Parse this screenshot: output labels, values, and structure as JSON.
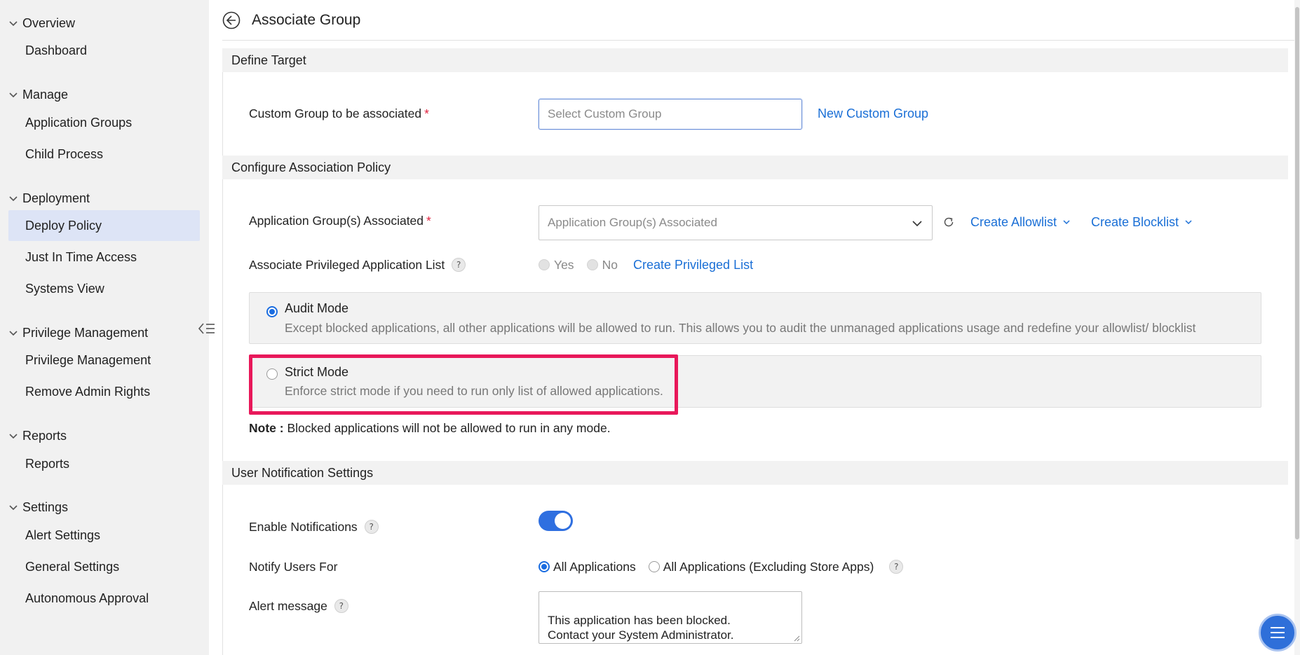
{
  "sidebar": {
    "sections": [
      {
        "title": "Overview",
        "items": [
          "Dashboard"
        ]
      },
      {
        "title": "Manage",
        "items": [
          "Application Groups",
          "Child Process"
        ]
      },
      {
        "title": "Deployment",
        "items": [
          "Deploy Policy",
          "Just In Time Access",
          "Systems View"
        ]
      },
      {
        "title": "Privilege Management",
        "items": [
          "Privilege Management",
          "Remove Admin Rights"
        ]
      },
      {
        "title": "Reports",
        "items": [
          "Reports"
        ]
      },
      {
        "title": "Settings",
        "items": [
          "Alert Settings",
          "General Settings",
          "Autonomous Approval"
        ]
      }
    ],
    "active_item": "Deploy Policy"
  },
  "header": {
    "title": "Associate Group"
  },
  "define_target": {
    "section_title": "Define Target",
    "custom_group_label": "Custom Group to be associated",
    "required_mark": "*",
    "custom_group_placeholder": "Select Custom Group",
    "new_custom_group_link": "New Custom Group"
  },
  "policy": {
    "section_title": "Configure Association Policy",
    "app_groups_label": "Application Group(s) Associated",
    "required_mark": "*",
    "app_groups_placeholder": "Application Group(s) Associated",
    "create_allowlist": "Create Allowlist",
    "create_blocklist": "Create Blocklist",
    "privileged_label": "Associate Privileged Application List",
    "help_mark": "?",
    "yes_label": "Yes",
    "no_label": "No",
    "create_privileged_link": "Create Privileged List",
    "audit_title": "Audit Mode",
    "audit_desc": "Except blocked applications, all other applications will be allowed to run. This allows you to audit the unmanaged applications usage and redefine your allowlist/ blocklist",
    "strict_title": "Strict Mode",
    "strict_desc": "Enforce strict mode if you need to run only list of allowed applications.",
    "selected_mode": "Audit Mode",
    "note_label": "Note :",
    "note_text": "Blocked applications will not be allowed to run in any mode."
  },
  "notifications": {
    "section_title": "User Notification Settings",
    "enable_label": "Enable Notifications",
    "enabled": true,
    "notify_label": "Notify Users For",
    "opt_all": "All Applications",
    "opt_excl": "All Applications (Excluding Store Apps)",
    "alert_label": "Alert message",
    "alert_message": "This application has been blocked.\nContact your System Administrator."
  },
  "colors": {
    "accent": "#1a6fd6",
    "highlight": "#e8185a",
    "active_nav": "#dde4f6"
  }
}
